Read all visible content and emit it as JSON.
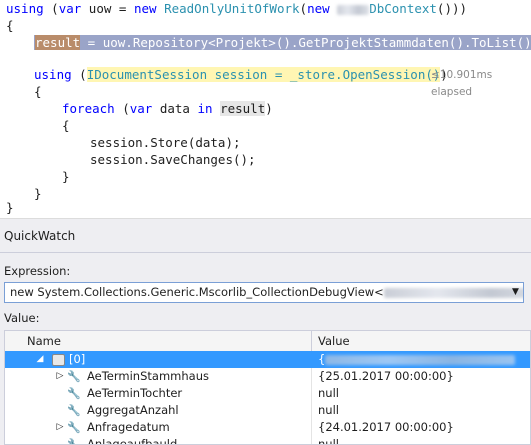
{
  "code": {
    "l1_using": "using",
    "l1_a": " (",
    "l1_var": "var",
    "l1_b": " uow = ",
    "l1_new": "new",
    "l1_c": " ",
    "l1_type": "ReadOnlyUnitOfWork",
    "l1_d": "(",
    "l1_new2": "new",
    "l1_e": " ",
    "l1_dbctx": "DbContext",
    "l1_f": "()))",
    "l2": "{",
    "l3_result": "result",
    "l3_rest": " = uow.Repository<Projekt>().GetProjektStammdaten().ToList();",
    "l5_using": "using",
    "l5_a": " (",
    "l5_hl": "IDocumentSession session = _store.OpenSession()",
    "l5_b": ")",
    "elapsed": "≤10.901ms elapsed",
    "l6": "{",
    "l7_foreach": "foreach",
    "l7_a": " (",
    "l7_var": "var",
    "l7_b": " data ",
    "l7_in": "in",
    "l7_c": " ",
    "l7_result": "result",
    "l7_d": ")",
    "l8": "{",
    "l9": "session.Store(data);",
    "l10": "session.SaveChanges();",
    "l11": "}",
    "l12": "}",
    "l13": "}"
  },
  "quickwatch": {
    "title": "QuickWatch",
    "expression_label": "Expression:",
    "expression_value": "new System.Collections.Generic.Mscorlib_CollectionDebugView<",
    "value_label": "Value:",
    "columns": {
      "name": "Name",
      "value": "Value"
    },
    "rows": [
      {
        "name": "[0]",
        "value": "{"
      },
      {
        "name": "AeTerminStammhaus",
        "value": "{25.01.2017 00:00:00}"
      },
      {
        "name": "AeTerminTochter",
        "value": "null"
      },
      {
        "name": "AggregatAnzahl",
        "value": "null"
      },
      {
        "name": "Anfragedatum",
        "value": "{24.01.2017 00:00:00}"
      },
      {
        "name": "Anlageaufbauld",
        "value": "null"
      }
    ]
  },
  "colors": {
    "keyword": "#0000ff",
    "type": "#2b91af",
    "selection": "#3399ff"
  }
}
